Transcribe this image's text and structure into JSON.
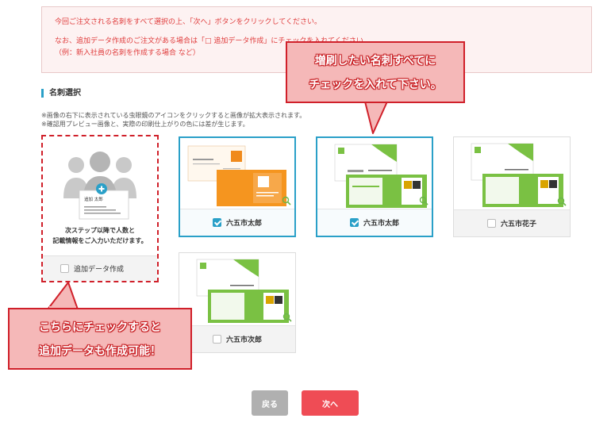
{
  "notice": {
    "line1": "今回ご注文される名刺をすべて選択の上、「次へ」ボタンをクリックしてください。",
    "line2": "なお、追加データ作成のご注文がある場合は「□ 追加データ作成」にチェックを入れてください。",
    "line3": "（例：新入社員の名刺を作成する場合 など）"
  },
  "section_title": "名刺選択",
  "notes": [
    "※画像の右下に表示されている虫眼鏡のアイコンをクリックすると画像が拡大表示されます。",
    "※確認用プレビュー画像と、実際の印刷仕上がりの色には差が生じます。"
  ],
  "add_card": {
    "preview_name": "追加 太郎",
    "message_line1": "次ステップ以降で人数と",
    "message_line2": "記載情報をご入力いただけます。",
    "checkbox_label": "追加データ作成",
    "checked": false
  },
  "cards": [
    {
      "label": "六五市太郎",
      "checked": true,
      "style": "orange"
    },
    {
      "label": "六五市太郎",
      "checked": true,
      "style": "green"
    },
    {
      "label": "六五市花子",
      "checked": false,
      "style": "green"
    },
    {
      "label": "六五市次郎",
      "checked": false,
      "style": "green"
    }
  ],
  "callouts": {
    "top_line1": "増刷したい名刺すべてに",
    "top_line2": "チェックを入れて下さい。",
    "bottom_line1": "こちらにチェックすると",
    "bottom_line2": "追加データも作成可能！"
  },
  "buttons": {
    "back": "戻る",
    "next": "次へ"
  },
  "colors": {
    "accent": "#2aa0c8",
    "alert": "#e03c3c",
    "next_button": "#ef4c55",
    "back_button": "#b0b0b0",
    "callout_border": "#d0202a"
  }
}
